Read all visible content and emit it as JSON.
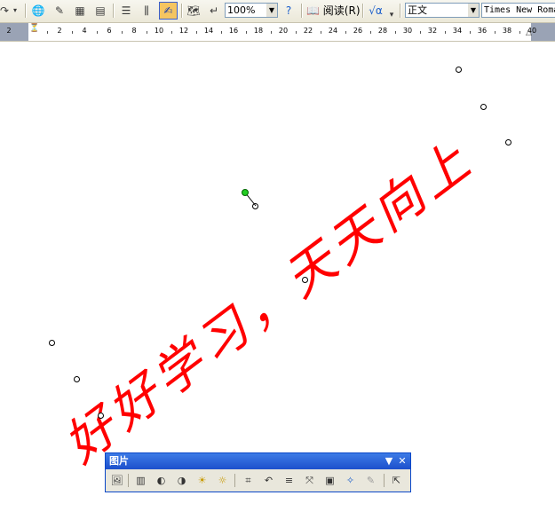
{
  "toolbar": {
    "zoom": "100%",
    "read_label": "阅读",
    "read_shortcut": "(R)",
    "style": "正文",
    "font": "Times New Roman",
    "icons": {
      "undo": "undo-icon",
      "undo_arrow": "dropdown-arrow-icon",
      "hyperlink": "hyperlink-icon",
      "tables_borders": "tables-borders-icon",
      "insert_table": "insert-table-icon",
      "insert_excel": "insert-excel-icon",
      "columns": "columns-icon",
      "drawing": "drawing-icon",
      "document_map": "document-map-icon",
      "show_hide": "show-hide-icon",
      "help": "help-icon",
      "read": "read-icon",
      "equation": "equation-icon"
    }
  },
  "ruler": {
    "labels": [
      "2",
      "2",
      "4",
      "6",
      "8",
      "10",
      "12",
      "14",
      "16",
      "18",
      "20",
      "22",
      "24",
      "26",
      "28",
      "30",
      "32",
      "34",
      "36",
      "38",
      "40"
    ]
  },
  "wordart": {
    "text": "好好学习，天天向上",
    "color": "#ff0000"
  },
  "picture_toolbar": {
    "title": "图片",
    "icons": [
      "insert-picture-icon",
      "color-icon",
      "more-contrast-icon",
      "less-contrast-icon",
      "more-brightness-icon",
      "less-brightness-icon",
      "crop-icon",
      "rotate-left-icon",
      "line-style-icon",
      "compress-pictures-icon",
      "text-wrapping-icon",
      "format-picture-icon",
      "set-transparent-color-icon",
      "reset-picture-icon"
    ]
  }
}
